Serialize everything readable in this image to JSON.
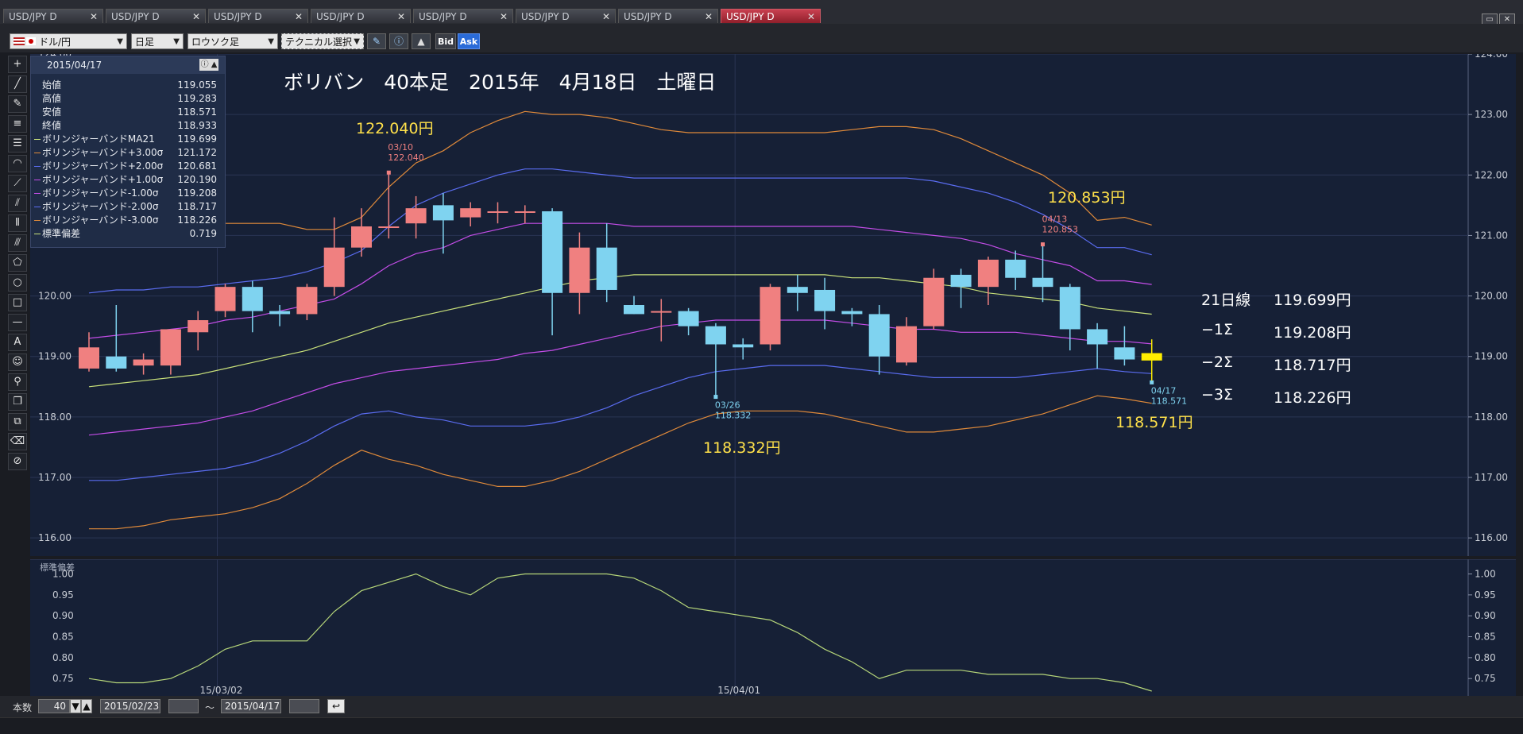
{
  "tabs": [
    {
      "label": "USD/JPY D"
    },
    {
      "label": "USD/JPY D"
    },
    {
      "label": "USD/JPY D"
    },
    {
      "label": "USD/JPY D"
    },
    {
      "label": "USD/JPY D"
    },
    {
      "label": "USD/JPY D"
    },
    {
      "label": "USD/JPY D"
    },
    {
      "label": "USD/JPY D"
    }
  ],
  "toolbar": {
    "pair": "ドル/円",
    "period": "日足",
    "style": "ロウソク足",
    "technical": "テクニカル選択",
    "bid": "Bid",
    "ask": "Ask"
  },
  "info": {
    "date": "2015/04/17",
    "rows": [
      {
        "label": "始値",
        "value": "119.055",
        "color": ""
      },
      {
        "label": "高値",
        "value": "119.283",
        "color": ""
      },
      {
        "label": "安値",
        "value": "118.571",
        "color": ""
      },
      {
        "label": "終値",
        "value": "118.933",
        "color": ""
      },
      {
        "label": "ボリンジャーバンドMA21",
        "value": "119.699",
        "color": "#c8e07a"
      },
      {
        "label": "ボリンジャーバンド+3.00σ",
        "value": "121.172",
        "color": "#e08a3a"
      },
      {
        "label": "ボリンジャーバンド+2.00σ",
        "value": "120.681",
        "color": "#5a6cf0"
      },
      {
        "label": "ボリンジャーバンド+1.00σ",
        "value": "120.190",
        "color": "#c44de8"
      },
      {
        "label": "ボリンジャーバンド-1.00σ",
        "value": "119.208",
        "color": "#c44de8"
      },
      {
        "label": "ボリンジャーバンド-2.00σ",
        "value": "118.717",
        "color": "#5a6cf0"
      },
      {
        "label": "ボリンジャーバンド-3.00σ",
        "value": "118.226",
        "color": "#e08a3a"
      },
      {
        "label": "標準偏差",
        "value": "0.719",
        "color": "#c8e07a"
      }
    ]
  },
  "overlay": {
    "title": "ボリバン　40本足　2015年　4月18日　土曜日",
    "high_label": "122.040円",
    "high2_label": "120.853円",
    "low_label": "118.332円",
    "low2_label": "118.571円",
    "legend": [
      {
        "name": "21日線",
        "value": "119.699円"
      },
      {
        "name": "−1Σ",
        "value": "119.208円"
      },
      {
        "name": "−2Σ",
        "value": "118.717円"
      },
      {
        "name": "−3Σ",
        "value": "118.226円"
      }
    ]
  },
  "chart_data": [
    {
      "type": "candlestick",
      "y_ticks": [
        "124.00",
        "123.00",
        "122.00",
        "121.00",
        "120.00",
        "119.00",
        "118.00",
        "117.00",
        "116.00"
      ],
      "ylim": [
        115.7,
        124.0
      ],
      "x_labels": [
        "15/03/02",
        "15/04/01"
      ],
      "colors": {
        "up": "#f08080",
        "down": "#7fd3f0",
        "last": "#ffee00"
      },
      "candles": [
        {
          "o": 118.8,
          "h": 119.4,
          "l": 118.75,
          "c": 119.15
        },
        {
          "o": 119.0,
          "h": 119.85,
          "l": 118.75,
          "c": 118.8
        },
        {
          "o": 118.85,
          "h": 119.05,
          "l": 118.7,
          "c": 118.95
        },
        {
          "o": 118.85,
          "h": 119.45,
          "l": 118.7,
          "c": 119.45
        },
        {
          "o": 119.4,
          "h": 119.75,
          "l": 119.1,
          "c": 119.6
        },
        {
          "o": 119.75,
          "h": 120.2,
          "l": 119.65,
          "c": 120.15
        },
        {
          "o": 120.15,
          "h": 120.25,
          "l": 119.4,
          "c": 119.75
        },
        {
          "o": 119.75,
          "h": 119.85,
          "l": 119.5,
          "c": 119.7
        },
        {
          "o": 119.7,
          "h": 120.2,
          "l": 119.6,
          "c": 120.15
        },
        {
          "o": 120.15,
          "h": 121.3,
          "l": 120.0,
          "c": 120.8
        },
        {
          "o": 120.8,
          "h": 121.45,
          "l": 120.65,
          "c": 121.15
        },
        {
          "o": 121.15,
          "h": 122.04,
          "l": 120.95,
          "c": 121.15
        },
        {
          "o": 121.2,
          "h": 121.65,
          "l": 120.95,
          "c": 121.45
        },
        {
          "o": 121.5,
          "h": 121.7,
          "l": 120.7,
          "c": 121.25
        },
        {
          "o": 121.3,
          "h": 121.55,
          "l": 121.15,
          "c": 121.45
        },
        {
          "o": 121.4,
          "h": 121.55,
          "l": 121.2,
          "c": 121.4
        },
        {
          "o": 121.4,
          "h": 121.5,
          "l": 121.2,
          "c": 121.4
        },
        {
          "o": 121.4,
          "h": 121.45,
          "l": 119.35,
          "c": 120.05
        },
        {
          "o": 120.05,
          "h": 121.05,
          "l": 119.7,
          "c": 120.8
        },
        {
          "o": 120.8,
          "h": 121.2,
          "l": 119.9,
          "c": 120.1
        },
        {
          "o": 119.85,
          "h": 120.0,
          "l": 119.7,
          "c": 119.7
        },
        {
          "o": 119.75,
          "h": 119.95,
          "l": 119.25,
          "c": 119.75
        },
        {
          "o": 119.75,
          "h": 119.8,
          "l": 119.35,
          "c": 119.5
        },
        {
          "o": 119.5,
          "h": 119.55,
          "l": 118.332,
          "c": 119.2
        },
        {
          "o": 119.2,
          "h": 119.3,
          "l": 118.95,
          "c": 119.15
        },
        {
          "o": 119.2,
          "h": 120.2,
          "l": 119.1,
          "c": 120.15
        },
        {
          "o": 120.15,
          "h": 120.35,
          "l": 119.75,
          "c": 120.05
        },
        {
          "o": 120.1,
          "h": 120.3,
          "l": 119.45,
          "c": 119.75
        },
        {
          "o": 119.75,
          "h": 119.8,
          "l": 119.5,
          "c": 119.7
        },
        {
          "o": 119.7,
          "h": 119.85,
          "l": 118.7,
          "c": 119.0
        },
        {
          "o": 118.9,
          "h": 119.65,
          "l": 118.85,
          "c": 119.5
        },
        {
          "o": 119.5,
          "h": 120.45,
          "l": 119.45,
          "c": 120.3
        },
        {
          "o": 120.35,
          "h": 120.45,
          "l": 119.8,
          "c": 120.15
        },
        {
          "o": 120.15,
          "h": 120.65,
          "l": 119.85,
          "c": 120.6
        },
        {
          "o": 120.6,
          "h": 120.75,
          "l": 120.1,
          "c": 120.3
        },
        {
          "o": 120.3,
          "h": 120.853,
          "l": 119.9,
          "c": 120.15
        },
        {
          "o": 120.15,
          "h": 120.2,
          "l": 119.1,
          "c": 119.45
        },
        {
          "o": 119.45,
          "h": 119.55,
          "l": 118.8,
          "c": 119.2
        },
        {
          "o": 119.15,
          "h": 119.5,
          "l": 118.85,
          "c": 118.95
        },
        {
          "o": 119.055,
          "h": 119.283,
          "l": 118.571,
          "c": 118.933
        }
      ],
      "bands": [
        {
          "name": "+3σ",
          "color": "#e08a3a",
          "values": [
            121.1,
            121.2,
            121.2,
            121.2,
            121.2,
            121.2,
            121.2,
            121.2,
            121.1,
            121.1,
            121.3,
            121.8,
            122.2,
            122.4,
            122.7,
            122.9,
            123.05,
            123.0,
            123.0,
            122.95,
            122.85,
            122.75,
            122.7,
            122.7,
            122.7,
            122.7,
            122.7,
            122.7,
            122.75,
            122.8,
            122.8,
            122.75,
            122.6,
            122.4,
            122.2,
            122.0,
            121.7,
            121.25,
            121.3,
            121.172
          ]
        },
        {
          "name": "+2σ",
          "color": "#5a6cf0",
          "values": [
            120.05,
            120.1,
            120.1,
            120.15,
            120.15,
            120.2,
            120.25,
            120.3,
            120.4,
            120.55,
            120.75,
            121.15,
            121.5,
            121.7,
            121.85,
            122.0,
            122.1,
            122.1,
            122.05,
            122.0,
            121.95,
            121.95,
            121.95,
            121.95,
            121.95,
            121.95,
            121.95,
            121.95,
            121.95,
            121.95,
            121.95,
            121.9,
            121.8,
            121.7,
            121.55,
            121.35,
            121.1,
            120.8,
            120.8,
            120.681
          ]
        },
        {
          "name": "+1σ",
          "color": "#c44de8",
          "values": [
            119.3,
            119.35,
            119.4,
            119.45,
            119.5,
            119.6,
            119.65,
            119.75,
            119.85,
            119.95,
            120.2,
            120.5,
            120.7,
            120.8,
            121.0,
            121.1,
            121.2,
            121.2,
            121.2,
            121.2,
            121.15,
            121.15,
            121.15,
            121.15,
            121.15,
            121.15,
            121.15,
            121.15,
            121.15,
            121.1,
            121.05,
            121.0,
            120.95,
            120.85,
            120.7,
            120.6,
            120.5,
            120.25,
            120.25,
            120.19
          ]
        },
        {
          "name": "MA21",
          "color": "#c8e07a",
          "values": [
            118.5,
            118.55,
            118.6,
            118.65,
            118.7,
            118.8,
            118.9,
            119.0,
            119.1,
            119.25,
            119.4,
            119.55,
            119.65,
            119.75,
            119.85,
            119.95,
            120.05,
            120.15,
            120.25,
            120.3,
            120.35,
            120.35,
            120.35,
            120.35,
            120.35,
            120.35,
            120.35,
            120.35,
            120.3,
            120.3,
            120.25,
            120.2,
            120.15,
            120.05,
            120.0,
            119.95,
            119.9,
            119.8,
            119.75,
            119.699
          ]
        },
        {
          "name": "-1σ",
          "color": "#c44de8",
          "values": [
            117.7,
            117.75,
            117.8,
            117.85,
            117.9,
            118.0,
            118.1,
            118.25,
            118.4,
            118.55,
            118.65,
            118.75,
            118.8,
            118.85,
            118.9,
            118.95,
            119.05,
            119.1,
            119.2,
            119.3,
            119.4,
            119.5,
            119.55,
            119.6,
            119.6,
            119.6,
            119.6,
            119.6,
            119.55,
            119.5,
            119.45,
            119.45,
            119.4,
            119.4,
            119.4,
            119.35,
            119.3,
            119.25,
            119.25,
            119.208
          ]
        },
        {
          "name": "-2σ",
          "color": "#5a6cf0",
          "values": [
            116.95,
            116.95,
            117.0,
            117.05,
            117.1,
            117.15,
            117.25,
            117.4,
            117.6,
            117.85,
            118.05,
            118.1,
            118.0,
            117.95,
            117.85,
            117.85,
            117.85,
            117.9,
            118.0,
            118.15,
            118.35,
            118.5,
            118.65,
            118.75,
            118.8,
            118.85,
            118.85,
            118.85,
            118.8,
            118.75,
            118.7,
            118.65,
            118.65,
            118.65,
            118.65,
            118.7,
            118.75,
            118.8,
            118.75,
            118.717
          ]
        },
        {
          "name": "-3σ",
          "color": "#e08a3a",
          "values": [
            116.15,
            116.15,
            116.2,
            116.3,
            116.35,
            116.4,
            116.5,
            116.65,
            116.9,
            117.2,
            117.45,
            117.3,
            117.2,
            117.05,
            116.95,
            116.85,
            116.85,
            116.95,
            117.1,
            117.3,
            117.5,
            117.7,
            117.9,
            118.05,
            118.1,
            118.1,
            118.1,
            118.05,
            117.95,
            117.85,
            117.75,
            117.75,
            117.8,
            117.85,
            117.95,
            118.05,
            118.2,
            118.35,
            118.3,
            118.226
          ]
        }
      ],
      "annotations": [
        {
          "date": "03/10",
          "value": "122.040",
          "color": "#f08080",
          "index": 11,
          "price": 122.04,
          "pos": "above"
        },
        {
          "date": "04/13",
          "value": "120.853",
          "color": "#f08080",
          "index": 35,
          "price": 120.853,
          "pos": "above"
        },
        {
          "date": "03/26",
          "value": "118.332",
          "color": "#7fd3f0",
          "index": 23,
          "price": 118.332,
          "pos": "below"
        },
        {
          "date": "04/17",
          "value": "118.571",
          "color": "#7fd3f0",
          "index": 39,
          "price": 118.571,
          "pos": "below"
        }
      ]
    },
    {
      "type": "line",
      "title": "標準偏差",
      "y_ticks": [
        "1.00",
        "0.95",
        "0.90",
        "0.85",
        "0.80",
        "0.75"
      ],
      "ylim": [
        0.72,
        1.02
      ],
      "series": [
        {
          "color": "#b7d77a",
          "values": [
            0.75,
            0.74,
            0.74,
            0.75,
            0.78,
            0.82,
            0.84,
            0.84,
            0.84,
            0.91,
            0.96,
            0.98,
            1.0,
            0.97,
            0.95,
            0.99,
            1.0,
            1.0,
            1.0,
            1.0,
            0.99,
            0.96,
            0.92,
            0.91,
            0.9,
            0.89,
            0.86,
            0.82,
            0.79,
            0.75,
            0.77,
            0.77,
            0.77,
            0.76,
            0.76,
            0.76,
            0.75,
            0.75,
            0.74,
            0.72
          ]
        }
      ]
    }
  ],
  "bottom": {
    "count_label": "本数",
    "count_value": "40",
    "start_date": "2015/02/23",
    "tilde": "〜",
    "end_date": "2015/04/17"
  }
}
